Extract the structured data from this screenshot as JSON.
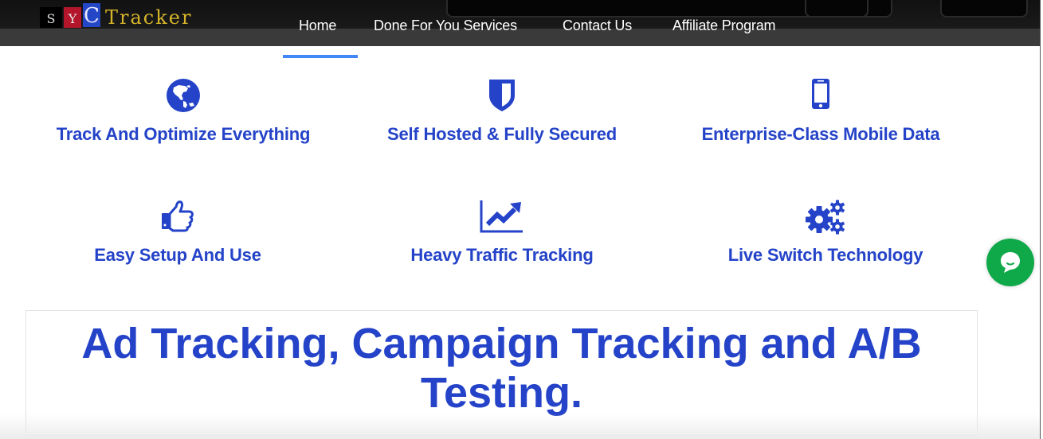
{
  "header": {
    "logo": {
      "letters": [
        "S",
        "Y",
        "C"
      ],
      "word": "Tracker"
    },
    "nav": [
      {
        "label": "Home",
        "active": true
      },
      {
        "label": "Done For You Services",
        "active": false
      },
      {
        "label": "Contact Us",
        "active": false
      },
      {
        "label": "Affiliate Program",
        "active": false
      }
    ],
    "active_color": "#4287f5"
  },
  "features": [
    {
      "icon": "globe-icon",
      "title": "Track And Optimize Everything"
    },
    {
      "icon": "shield-icon",
      "title": "Self Hosted & Fully Secured"
    },
    {
      "icon": "mobile-phone-icon",
      "title": "Enterprise-Class Mobile Data"
    },
    {
      "icon": "thumbs-up-icon",
      "title": "Easy Setup And Use"
    },
    {
      "icon": "line-chart-icon",
      "title": "Heavy Traffic Tracking"
    },
    {
      "icon": "gears-icon",
      "title": "Live Switch Technology"
    }
  ],
  "headline": "Ad Tracking, Campaign Tracking and A/B Testing.",
  "colors": {
    "accent": "#2443c8",
    "chat": "#0fa94a"
  },
  "chat_widget": {
    "icon": "chat-bubble-icon"
  }
}
